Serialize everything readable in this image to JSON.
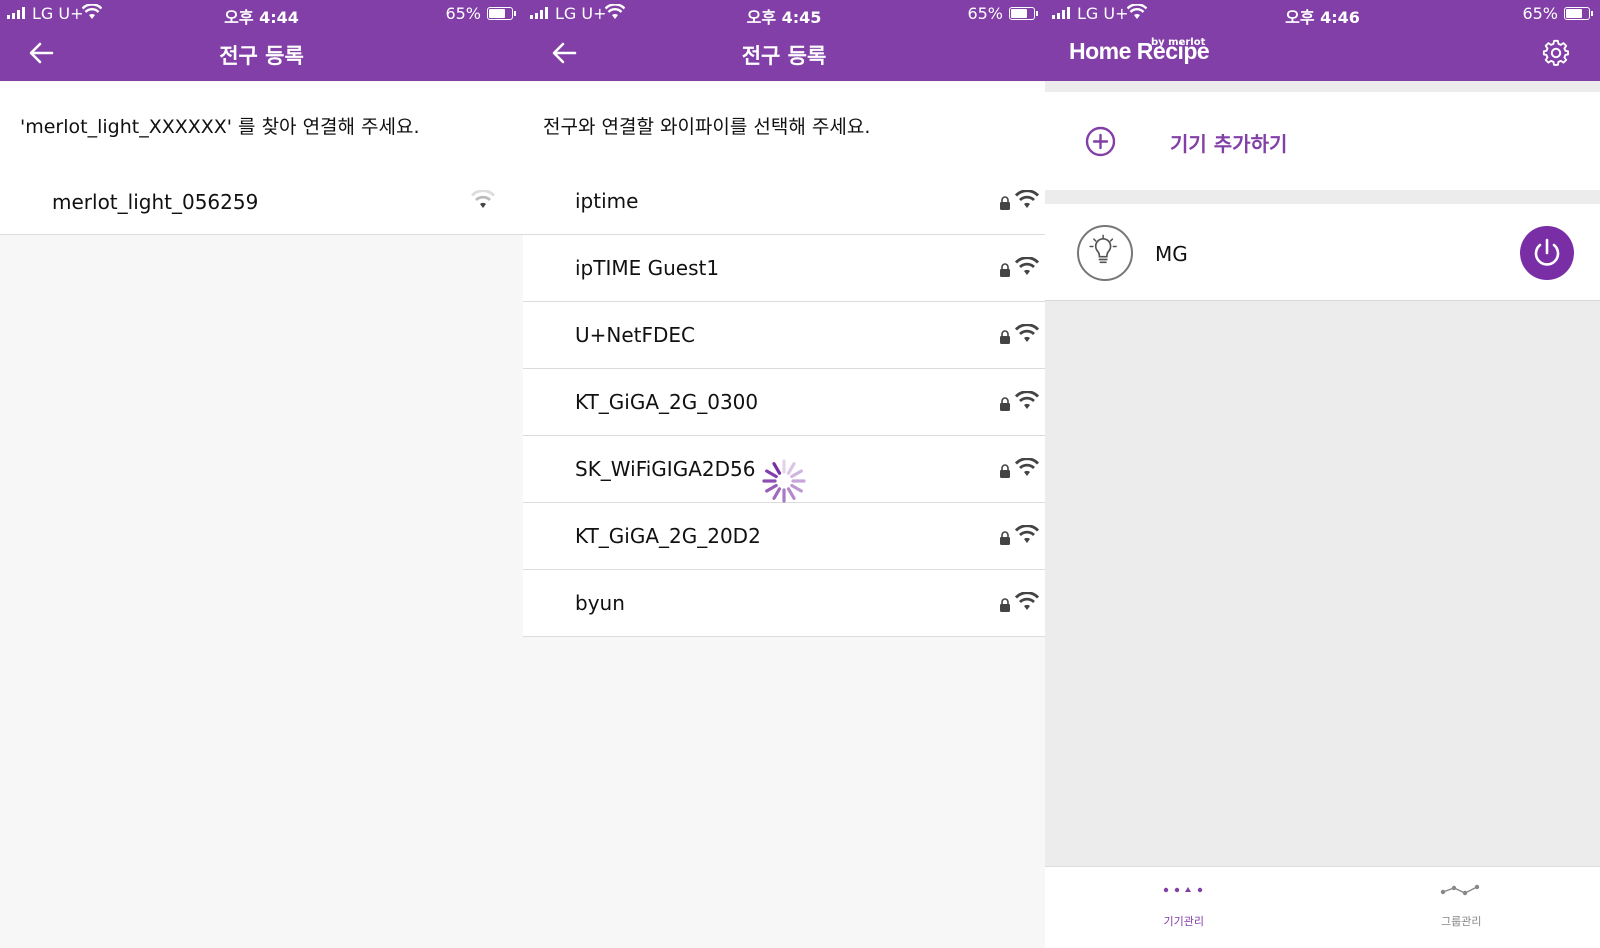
{
  "colors": {
    "brand": "#813fa7",
    "accent": "#7a2ea6",
    "icon_gray": "#555555",
    "faint_gray": "#999999"
  },
  "panel1": {
    "status": {
      "carrier": "LG U+",
      "time": "오후 4:44",
      "battery": "65%"
    },
    "title": "전구 등록",
    "instruction": "'merlot_light_XXXXXX' 를 찾아 연결해 주세요.",
    "networks": [
      {
        "name": "merlot_light_056259",
        "locked": false
      }
    ]
  },
  "panel2": {
    "status": {
      "carrier": "LG U+",
      "time": "오후 4:45",
      "battery": "65%"
    },
    "title": "전구 등록",
    "instruction": "전구와 연결할 와이파이를 선택해 주세요.",
    "networks": [
      {
        "name": "iptime",
        "locked": true
      },
      {
        "name": "ipTIME Guest1",
        "locked": true
      },
      {
        "name": "U+NetFDEC",
        "locked": true
      },
      {
        "name": "KT_GiGA_2G_0300",
        "locked": true
      },
      {
        "name": "SK_WiFiGIGA2D56",
        "locked": true
      },
      {
        "name": "KT_GiGA_2G_20D2",
        "locked": true
      },
      {
        "name": "byun",
        "locked": true
      }
    ],
    "loading": true
  },
  "panel3": {
    "status": {
      "carrier": "LG U+",
      "time": "오후 4:46",
      "battery": "65%"
    },
    "logo": "Home Recipe",
    "logo_by": "by merlot",
    "add_device_label": "기기 추가하기",
    "devices": [
      {
        "name": "MG",
        "icon": "bulb-icon",
        "power": "on"
      }
    ],
    "tabs": [
      {
        "label": "기기관리",
        "icon": "devices-icon",
        "active": true
      },
      {
        "label": "그룹관리",
        "icon": "group-icon",
        "active": false
      }
    ]
  }
}
